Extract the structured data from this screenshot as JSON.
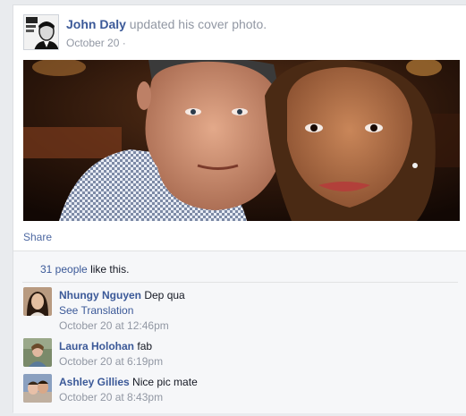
{
  "post": {
    "author": "John Daly",
    "action": "updated his cover photo.",
    "timestamp": "October 20 ·"
  },
  "share_label": "Share",
  "likes": {
    "count_text": "31 people",
    "suffix": "like this."
  },
  "comments": [
    {
      "name": "Nhungy Nguyen",
      "text": "Dep qua",
      "translation": "See Translation",
      "time": "October 20 at 12:46pm"
    },
    {
      "name": "Laura Holohan",
      "text": "fab",
      "time": "October 20 at 6:19pm"
    },
    {
      "name": "Ashley Gillies",
      "text": "Nice pic mate",
      "time": "October 20 at 8:43pm"
    }
  ],
  "colors": {
    "link": "#3b5998",
    "muted": "#9197a3",
    "background": "#e9ebee",
    "ufi_background": "#f6f7f9"
  }
}
